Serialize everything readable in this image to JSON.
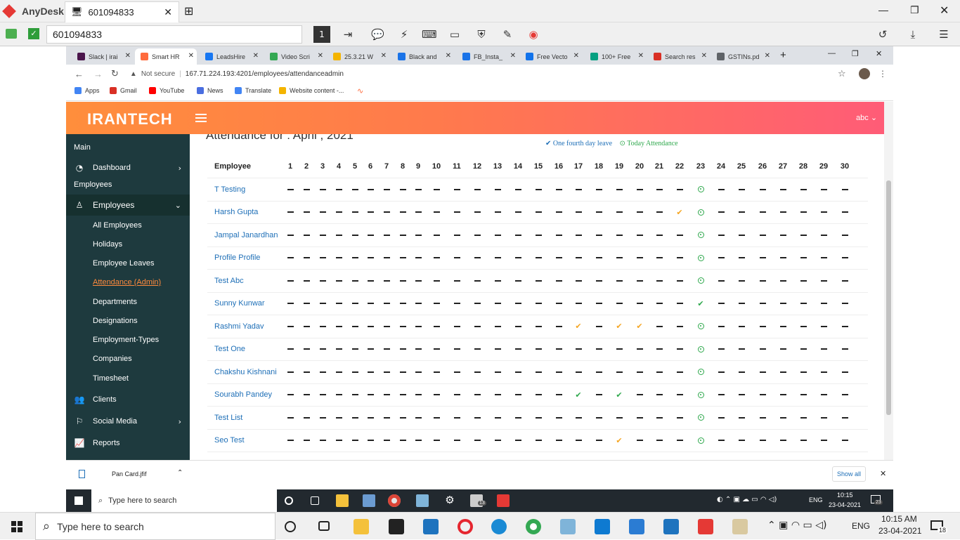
{
  "anydesk": {
    "brand": "AnyDesk",
    "session_tab": "601094833",
    "address": "601094833"
  },
  "browser": {
    "tabs": [
      {
        "label": "Slack | irai",
        "color": "#4a154b"
      },
      {
        "label": "Smart HR",
        "color": "#ff6b3d"
      },
      {
        "label": "LeadsHire",
        "color": "#1877f2"
      },
      {
        "label": "Video Scri",
        "color": "#34a853"
      },
      {
        "label": "25.3.21 W",
        "color": "#f4b400"
      },
      {
        "label": "Black and",
        "color": "#1a73e8"
      },
      {
        "label": "FB_Insta_",
        "color": "#1a73e8"
      },
      {
        "label": "Free Vecto",
        "color": "#1273eb"
      },
      {
        "label": "100+ Free",
        "color": "#05a081"
      },
      {
        "label": "Search res",
        "color": "#d93025"
      },
      {
        "label": "GSTINs.pd",
        "color": "#5f6368"
      }
    ],
    "url_secure": "Not secure",
    "url": "167.71.224.193:4201/employees/attendanceadmin",
    "bookmarks": [
      "Apps",
      "Gmail",
      "YouTube",
      "News",
      "Translate",
      "Website content -..."
    ]
  },
  "app": {
    "logo": "IRANTECH",
    "user": "abc",
    "sidebar": {
      "main_heading": "Main",
      "dashboard": "Dashboard",
      "employees_heading": "Employees",
      "employees": "Employees",
      "sub_items": [
        "All Employees",
        "Holidays",
        "Employee Leaves",
        "Attendance (Admin)",
        "Departments",
        "Designations",
        "Employment-Types",
        "Companies",
        "Timesheet"
      ],
      "clients": "Clients",
      "social_media": "Social Media",
      "reports": "Reports"
    },
    "page_title": "Attendance for : April , 2021",
    "legend": {
      "one_fourth": "One fourth day leave",
      "today": "Today Attendance"
    },
    "table": {
      "employee_header": "Employee",
      "days": [
        "1",
        "2",
        "3",
        "4",
        "5",
        "6",
        "7",
        "8",
        "9",
        "10",
        "11",
        "12",
        "13",
        "14",
        "15",
        "16",
        "17",
        "18",
        "19",
        "20",
        "21",
        "22",
        "23",
        "24",
        "25",
        "26",
        "27",
        "28",
        "29",
        "30"
      ],
      "rows": [
        {
          "name": "T Testing",
          "marks": {
            "23": "ring"
          }
        },
        {
          "name": "Harsh Gupta",
          "marks": {
            "22": "check-orange",
            "23": "ring"
          }
        },
        {
          "name": "Jampal Janardhan",
          "marks": {
            "23": "ring"
          }
        },
        {
          "name": "Profile Profile",
          "marks": {
            "23": "ring"
          }
        },
        {
          "name": "Test Abc",
          "marks": {
            "23": "ring"
          }
        },
        {
          "name": "Sunny Kunwar",
          "marks": {
            "23": "check-green"
          }
        },
        {
          "name": "Rashmi Yadav",
          "marks": {
            "17": "check-orange",
            "19": "check-orange",
            "20": "check-orange",
            "23": "ring"
          }
        },
        {
          "name": "Test One",
          "marks": {
            "23": "ring"
          }
        },
        {
          "name": "Chakshu Kishnani",
          "marks": {
            "23": "ring"
          }
        },
        {
          "name": "Sourabh Pandey",
          "marks": {
            "17": "check-green",
            "19": "check-green",
            "23": "ring"
          }
        },
        {
          "name": "Test List",
          "marks": {
            "23": "ring"
          }
        },
        {
          "name": "Seo Test",
          "marks": {
            "19": "check-orange",
            "23": "ring"
          }
        }
      ]
    },
    "download": {
      "file": "Pan Card.jfif",
      "show_all": "Show all"
    }
  },
  "remote_taskbar": {
    "search": "Type here to search",
    "time": "10:15",
    "date": "23-04-2021",
    "lang": "ENG",
    "notif": "23",
    "mail_count": "13"
  },
  "taskbar": {
    "search": "Type here to search",
    "time": "10:15 AM",
    "date": "23-04-2021",
    "lang": "ENG",
    "notif": "18"
  },
  "colors": {
    "header_start": "#ff8e3c",
    "header_end": "#ff5c77",
    "sidebar": "#1e3a3e",
    "active_link": "#ff8a3d",
    "present_green": "#2ea84c",
    "leave_orange": "#f5a623",
    "link_blue": "#1e6fb7"
  }
}
